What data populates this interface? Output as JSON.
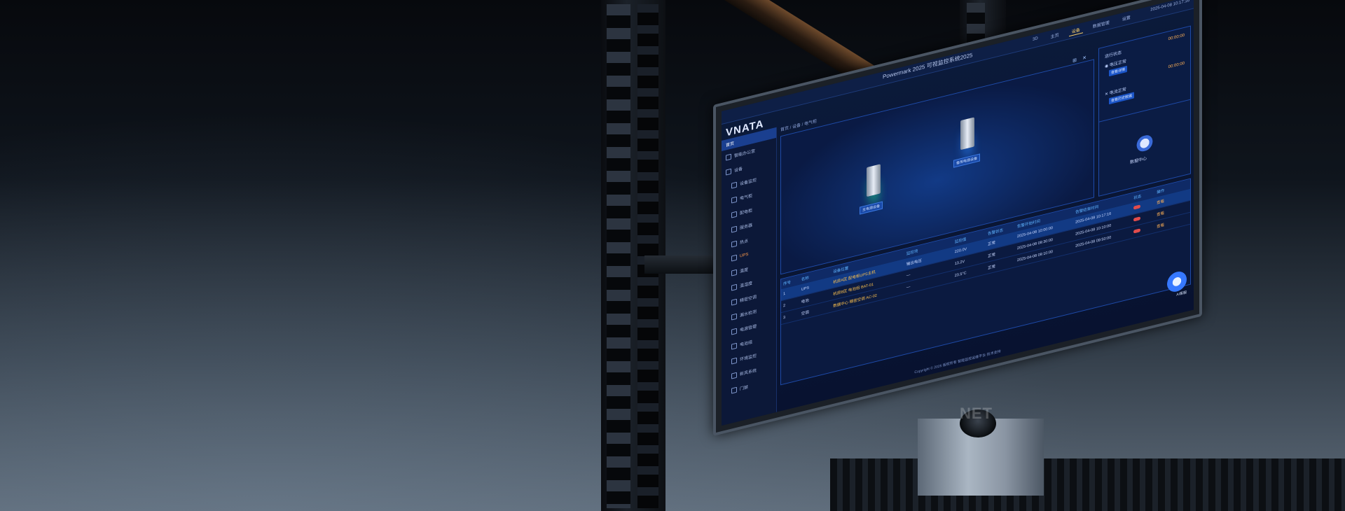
{
  "watermark": "NET",
  "app": {
    "logo": "VNATA",
    "title": "Powermark 2025 可视监控系统2025",
    "clock": "2025-04-08 10:17:16"
  },
  "top_tabs": [
    {
      "label": "3D",
      "active": false
    },
    {
      "label": "主页",
      "active": false
    },
    {
      "label": "设备",
      "active": true
    },
    {
      "label": "数据管理",
      "active": false
    },
    {
      "label": "设置",
      "active": false
    }
  ],
  "sidebar": {
    "home": "首页",
    "items": [
      {
        "label": "智能办公室",
        "top": true,
        "selected": false
      },
      {
        "label": "设备",
        "top": true,
        "selected": false
      },
      {
        "label": "设备监控",
        "top": false,
        "selected": false
      },
      {
        "label": "电气柜",
        "top": false,
        "selected": false
      },
      {
        "label": "配电柜",
        "top": false,
        "selected": false
      },
      {
        "label": "服务器",
        "top": false,
        "selected": false
      },
      {
        "label": "热点",
        "top": false,
        "selected": false
      },
      {
        "label": "UPS",
        "top": false,
        "selected": true
      },
      {
        "label": "温度",
        "top": false,
        "selected": false
      },
      {
        "label": "温湿度",
        "top": false,
        "selected": false
      },
      {
        "label": "精密空调",
        "top": false,
        "selected": false
      },
      {
        "label": "漏水检测",
        "top": false,
        "selected": false
      },
      {
        "label": "电源管理",
        "top": false,
        "selected": false
      },
      {
        "label": "电池组",
        "top": false,
        "selected": false
      },
      {
        "label": "环境监控",
        "top": false,
        "selected": false
      },
      {
        "label": "新风系统",
        "top": false,
        "selected": false
      },
      {
        "label": "门禁",
        "top": false,
        "selected": false
      }
    ]
  },
  "content": {
    "breadcrumb": "首页 / 设备 / 电气柜",
    "controls": [
      "⊞",
      "✕"
    ],
    "devices": [
      {
        "label": "主电源设备",
        "status": "green"
      },
      {
        "label": "备用电源设备",
        "status": "blue"
      }
    ],
    "status_panel": {
      "rows": [
        {
          "label": "运行状态",
          "time": "00:00:00"
        },
        {
          "label": "◉ 电压正常",
          "time": ""
        },
        {
          "label": "",
          "time": "00:00:00"
        },
        {
          "label": "✕ 电流正常",
          "time": ""
        }
      ],
      "buttons": [
        "查看详情",
        "查看历史数据"
      ],
      "cloud_label": "数据中心"
    },
    "table": {
      "headers": [
        "序号",
        "名称",
        "设备位置",
        "监控项",
        "监控值",
        "告警状态",
        "告警开始时间",
        "告警结束时间",
        "状态",
        "操作"
      ],
      "rows": [
        {
          "cells": [
            "1",
            "UPS",
            "机房A区 配电柜UPS主机",
            "输出电压",
            "220.0V",
            "正常",
            "2025-04-08 10:00:00",
            "2025-04-08 10:17:16",
            "",
            "查看"
          ],
          "highlight": true
        },
        {
          "cells": [
            "2",
            "电池",
            "机房B区 电池组 BAT-01",
            "—",
            "13.2V",
            "正常",
            "2025-04-08 09:30:00",
            "2025-04-08 10:10:00",
            "",
            "查看"
          ],
          "highlight": false
        },
        {
          "cells": [
            "3",
            "空调",
            "数据中心 精密空调 AC-02",
            "—",
            "23.5°C",
            "正常",
            "2025-04-08 09:10:00",
            "2025-04-08 09:50:00",
            "",
            "查看"
          ],
          "highlight": false
        }
      ]
    },
    "bot_label": "AI客服"
  },
  "footer": "Copyright © 2025 版权所有 智能监控运维平台 技术支持",
  "colors": {
    "accent": "#1c56c9",
    "alert": "#ffb155",
    "active_tab": "#ffd36a"
  }
}
